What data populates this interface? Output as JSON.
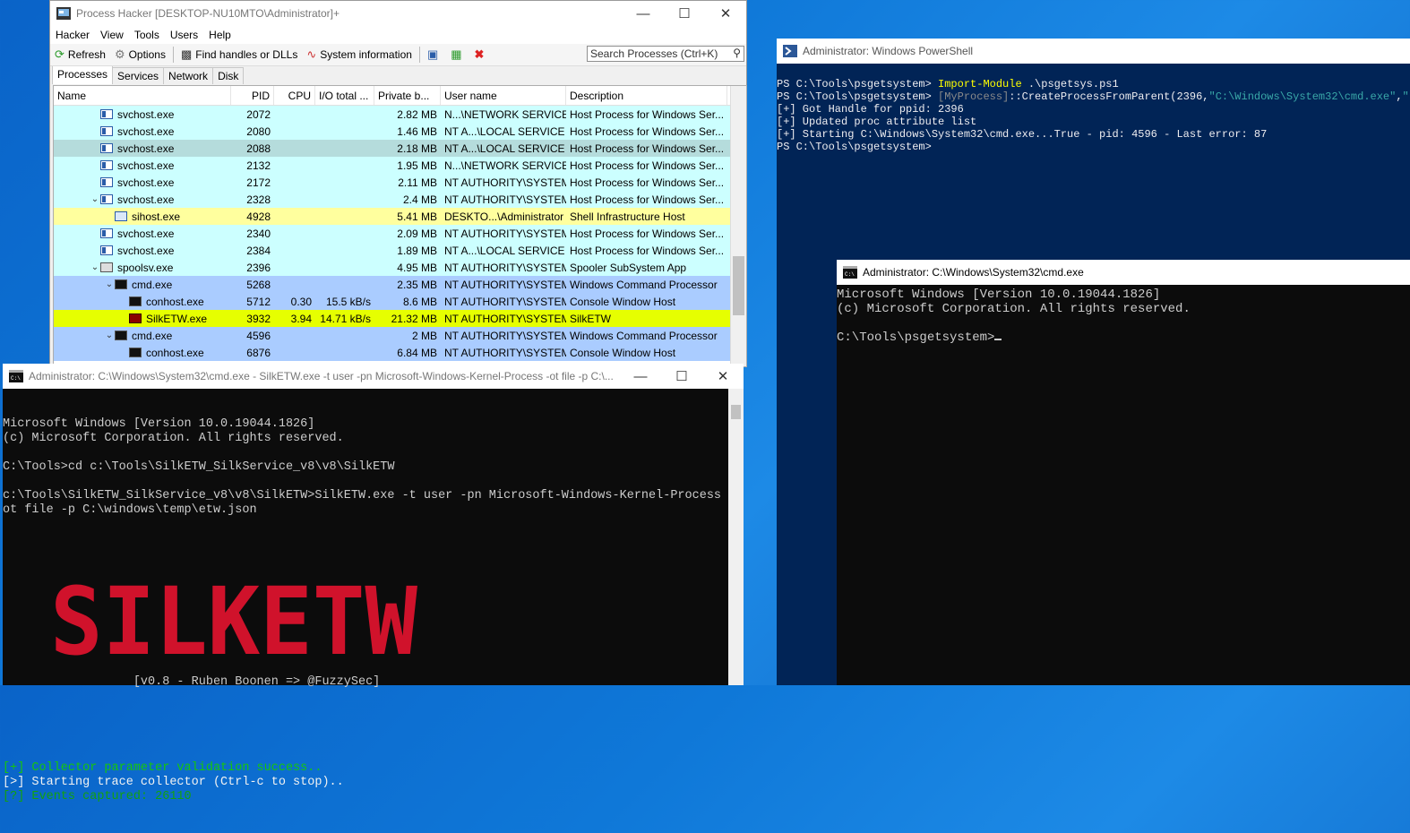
{
  "process_hacker": {
    "title": "Process Hacker [DESKTOP-NU10MTO\\Administrator]+",
    "menu": [
      "Hacker",
      "View",
      "Tools",
      "Users",
      "Help"
    ],
    "toolbar": {
      "refresh": "Refresh",
      "options": "Options",
      "find": "Find handles or DLLs",
      "sysinfo": "System information"
    },
    "search_placeholder": "Search Processes (Ctrl+K)",
    "tabs": [
      "Processes",
      "Services",
      "Network",
      "Disk"
    ],
    "columns": [
      "Name",
      "PID",
      "CPU",
      "I/O total ...",
      "Private b...",
      "User name",
      "Description"
    ],
    "rows": [
      {
        "name": "svchost.exe",
        "pid": "2072",
        "cpu": "",
        "io": "",
        "priv": "2.82 MB",
        "user": "N...\\NETWORK SERVICE",
        "desc": "Host Process for Windows Ser...",
        "bg": "#ccffff",
        "icon": "service-icon",
        "indent": 0,
        "expander": ""
      },
      {
        "name": "svchost.exe",
        "pid": "2080",
        "cpu": "",
        "io": "",
        "priv": "1.46 MB",
        "user": "NT A...\\LOCAL SERVICE",
        "desc": "Host Process for Windows Ser...",
        "bg": "#ccffff",
        "icon": "service-icon",
        "indent": 0,
        "expander": ""
      },
      {
        "name": "svchost.exe",
        "pid": "2088",
        "cpu": "",
        "io": "",
        "priv": "2.18 MB",
        "user": "NT A...\\LOCAL SERVICE",
        "desc": "Host Process for Windows Ser...",
        "bg": "#b5dcdc",
        "icon": "service-icon",
        "indent": 0,
        "expander": ""
      },
      {
        "name": "svchost.exe",
        "pid": "2132",
        "cpu": "",
        "io": "",
        "priv": "1.95 MB",
        "user": "N...\\NETWORK SERVICE",
        "desc": "Host Process for Windows Ser...",
        "bg": "#ccffff",
        "icon": "service-icon",
        "indent": 0,
        "expander": ""
      },
      {
        "name": "svchost.exe",
        "pid": "2172",
        "cpu": "",
        "io": "",
        "priv": "2.11 MB",
        "user": "NT AUTHORITY\\SYSTEM",
        "desc": "Host Process for Windows Ser...",
        "bg": "#ccffff",
        "icon": "service-icon",
        "indent": 0,
        "expander": ""
      },
      {
        "name": "svchost.exe",
        "pid": "2328",
        "cpu": "",
        "io": "",
        "priv": "2.4 MB",
        "user": "NT AUTHORITY\\SYSTEM",
        "desc": "Host Process for Windows Ser...",
        "bg": "#ccffff",
        "icon": "service-icon",
        "indent": 0,
        "expander": "v"
      },
      {
        "name": "sihost.exe",
        "pid": "4928",
        "cpu": "",
        "io": "",
        "priv": "5.41 MB",
        "user": "DESKTO...\\Administrator",
        "desc": "Shell Infrastructure Host",
        "bg": "#ffff9e",
        "icon": "sihost-icon",
        "indent": 1,
        "expander": ""
      },
      {
        "name": "svchost.exe",
        "pid": "2340",
        "cpu": "",
        "io": "",
        "priv": "2.09 MB",
        "user": "NT AUTHORITY\\SYSTEM",
        "desc": "Host Process for Windows Ser...",
        "bg": "#ccffff",
        "icon": "service-icon",
        "indent": 0,
        "expander": ""
      },
      {
        "name": "svchost.exe",
        "pid": "2384",
        "cpu": "",
        "io": "",
        "priv": "1.89 MB",
        "user": "NT A...\\LOCAL SERVICE",
        "desc": "Host Process for Windows Ser...",
        "bg": "#ccffff",
        "icon": "service-icon",
        "indent": 0,
        "expander": ""
      },
      {
        "name": "spoolsv.exe",
        "pid": "2396",
        "cpu": "",
        "io": "",
        "priv": "4.95 MB",
        "user": "NT AUTHORITY\\SYSTEM",
        "desc": "Spooler SubSystem App",
        "bg": "#ccffff",
        "icon": "printer-icon",
        "indent": 0,
        "expander": "v"
      },
      {
        "name": "cmd.exe",
        "pid": "5268",
        "cpu": "",
        "io": "",
        "priv": "2.35 MB",
        "user": "NT AUTHORITY\\SYSTEM",
        "desc": "Windows Command Processor",
        "bg": "#aaccff",
        "icon": "console-icon",
        "indent": 1,
        "expander": "v"
      },
      {
        "name": "conhost.exe",
        "pid": "5712",
        "cpu": "0.30",
        "io": "15.5 kB/s",
        "priv": "8.6 MB",
        "user": "NT AUTHORITY\\SYSTEM",
        "desc": "Console Window Host",
        "bg": "#aaccff",
        "icon": "console-icon",
        "indent": 2,
        "expander": ""
      },
      {
        "name": "SilkETW.exe",
        "pid": "3932",
        "cpu": "3.94",
        "io": "14.71 kB/s",
        "priv": "21.32 MB",
        "user": "NT AUTHORITY\\SYSTEM",
        "desc": "SilkETW",
        "bg": "#e6ff00",
        "icon": "silketw-icon",
        "indent": 2,
        "expander": ""
      },
      {
        "name": "cmd.exe",
        "pid": "4596",
        "cpu": "",
        "io": "",
        "priv": "2 MB",
        "user": "NT AUTHORITY\\SYSTEM",
        "desc": "Windows Command Processor",
        "bg": "#aaccff",
        "icon": "console-icon",
        "indent": 1,
        "expander": "v"
      },
      {
        "name": "conhost.exe",
        "pid": "6876",
        "cpu": "",
        "io": "",
        "priv": "6.84 MB",
        "user": "NT AUTHORITY\\SYSTEM",
        "desc": "Console Window Host",
        "bg": "#aaccff",
        "icon": "console-icon",
        "indent": 2,
        "expander": ""
      }
    ]
  },
  "powershell": {
    "title": "Administrator: Windows PowerShell",
    "lines": [
      [
        {
          "t": "PS C:\\Tools\\psgetsystem> ",
          "cls": ""
        },
        {
          "t": "Import-Module",
          "cls": "y"
        },
        {
          "t": " .\\psgetsys.ps1",
          "cls": ""
        }
      ],
      [
        {
          "t": "PS C:\\Tools\\psgetsystem> ",
          "cls": ""
        },
        {
          "t": "[MyProcess]",
          "cls": "g"
        },
        {
          "t": "::CreateProcessFromParent(2396,",
          "cls": ""
        },
        {
          "t": "\"C:\\Windows\\System32\\cmd.exe\"",
          "cls": "c"
        },
        {
          "t": ",",
          "cls": ""
        },
        {
          "t": "\"\"",
          "cls": "c"
        },
        {
          "t": ")",
          "cls": ""
        }
      ],
      [
        {
          "t": "[+] Got Handle for ppid: 2396",
          "cls": ""
        }
      ],
      [
        {
          "t": "[+] Updated proc attribute list",
          "cls": ""
        }
      ],
      [
        {
          "t": "[+] Starting C:\\Windows\\System32\\cmd.exe...True - pid: 4596 - Last error: 87",
          "cls": ""
        }
      ],
      [
        {
          "t": "PS C:\\Tools\\psgetsystem>",
          "cls": ""
        }
      ]
    ]
  },
  "cmd_right": {
    "title": "Administrator: C:\\Windows\\System32\\cmd.exe",
    "lines": [
      "Microsoft Windows [Version 10.0.19044.1826]",
      "(c) Microsoft Corporation. All rights reserved.",
      "",
      "C:\\Tools\\psgetsystem>"
    ]
  },
  "cmd_silk": {
    "title": "Administrator: C:\\Windows\\System32\\cmd.exe - SilkETW.exe  -t user -pn Microsoft-Windows-Kernel-Process -ot file -p C:\\...",
    "lines_top": [
      "Microsoft Windows [Version 10.0.19044.1826]",
      "(c) Microsoft Corporation. All rights reserved.",
      "",
      "C:\\Tools>cd c:\\Tools\\SilkETW_SilkService_v8\\v8\\SilkETW",
      "",
      "c:\\Tools\\SilkETW_SilkService_v8\\v8\\SilkETW>SilkETW.exe -t user -pn Microsoft-Windows-Kernel-Process -",
      "ot file -p C:\\windows\\temp\\etw.json"
    ],
    "banner": "SILKETW",
    "version_line": "                  [v0.8 - Ruben Boonen => @FuzzySec]",
    "status": [
      {
        "t": "[+] Collector parameter validation success..",
        "cls": "green"
      },
      {
        "t": "[>] Starting trace collector (Ctrl-c to stop)..",
        "cls": "white"
      },
      {
        "t": "[?] Events captured: 26110",
        "cls": "dgreen"
      }
    ]
  }
}
